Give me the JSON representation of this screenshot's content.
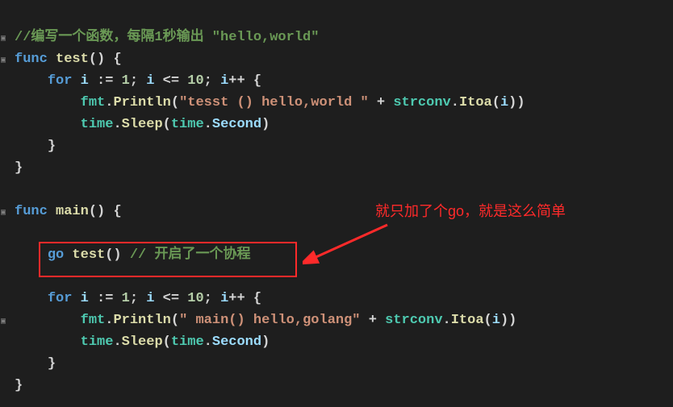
{
  "code": {
    "l1_comment": "//编写一个函数，每隔1秒输出 \"hello,world\"",
    "kw_func": "func",
    "fn_test": "test",
    "kw_for": "for",
    "var_i": "i",
    "op_assign": ":=",
    "num_1": "1",
    "op_le": "<=",
    "num_10": "10",
    "op_inc": "++",
    "pkg_fmt": "fmt",
    "fn_println": "Println",
    "str_test": "\"tesst () hello,world \"",
    "op_plus": "+",
    "pkg_strconv": "strconv",
    "fn_itoa": "Itoa",
    "pkg_time": "time",
    "fn_sleep": "Sleep",
    "const_second": "Second",
    "fn_main": "main",
    "kw_go": "go",
    "comment_go": "// 开启了一个协程",
    "str_main": "\" main() hello,golang\""
  },
  "annotation_text": "就只加了个go，就是这么简单"
}
